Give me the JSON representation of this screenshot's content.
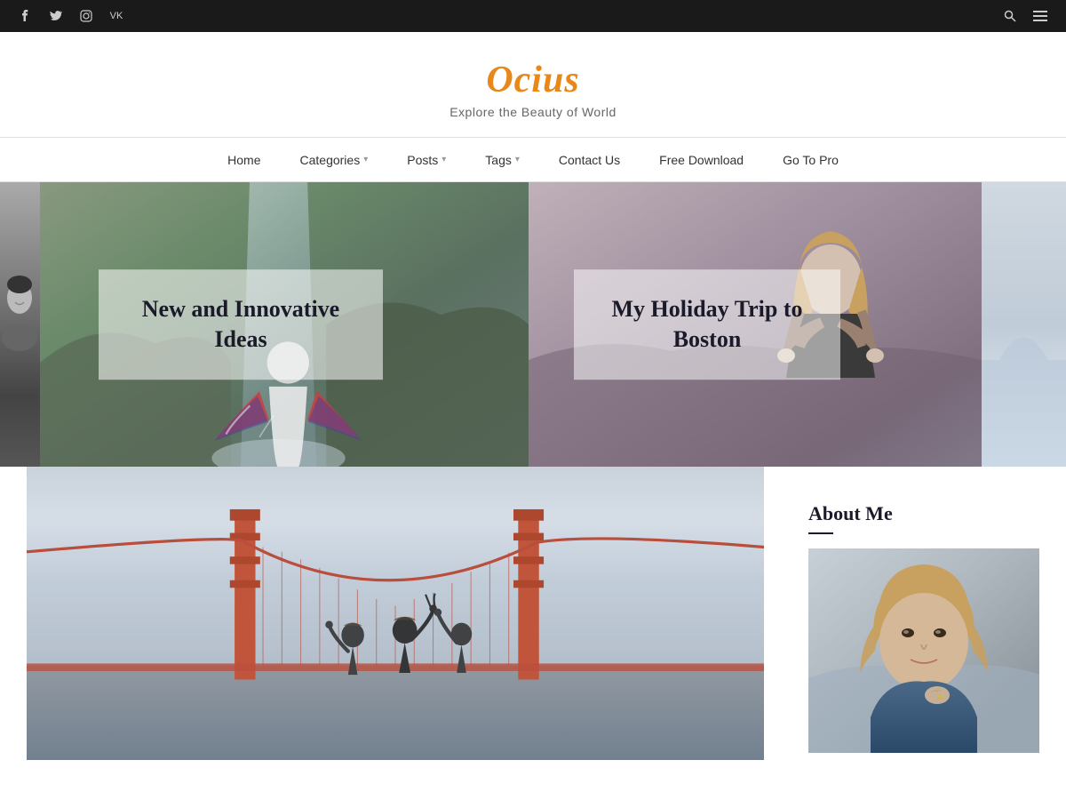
{
  "site": {
    "title": "Ocius",
    "tagline": "Explore the Beauty of World"
  },
  "topbar": {
    "social_icons": [
      {
        "name": "facebook",
        "symbol": "f"
      },
      {
        "name": "twitter",
        "symbol": "t"
      },
      {
        "name": "instagram",
        "symbol": "i"
      },
      {
        "name": "vk",
        "symbol": "vk"
      }
    ]
  },
  "nav": {
    "items": [
      {
        "label": "Home",
        "has_dropdown": false
      },
      {
        "label": "Categories",
        "has_dropdown": true
      },
      {
        "label": "Posts",
        "has_dropdown": true
      },
      {
        "label": "Tags",
        "has_dropdown": true
      },
      {
        "label": "Contact Us",
        "has_dropdown": false
      },
      {
        "label": "Free Download",
        "has_dropdown": false
      },
      {
        "label": "Go To Pro",
        "has_dropdown": false
      }
    ]
  },
  "hero": {
    "slides": [
      {
        "title": "New and Innovative Ideas"
      },
      {
        "title": "My Holiday Trip to Boston"
      }
    ]
  },
  "sidebar": {
    "about_me": {
      "title": "About Me"
    }
  }
}
